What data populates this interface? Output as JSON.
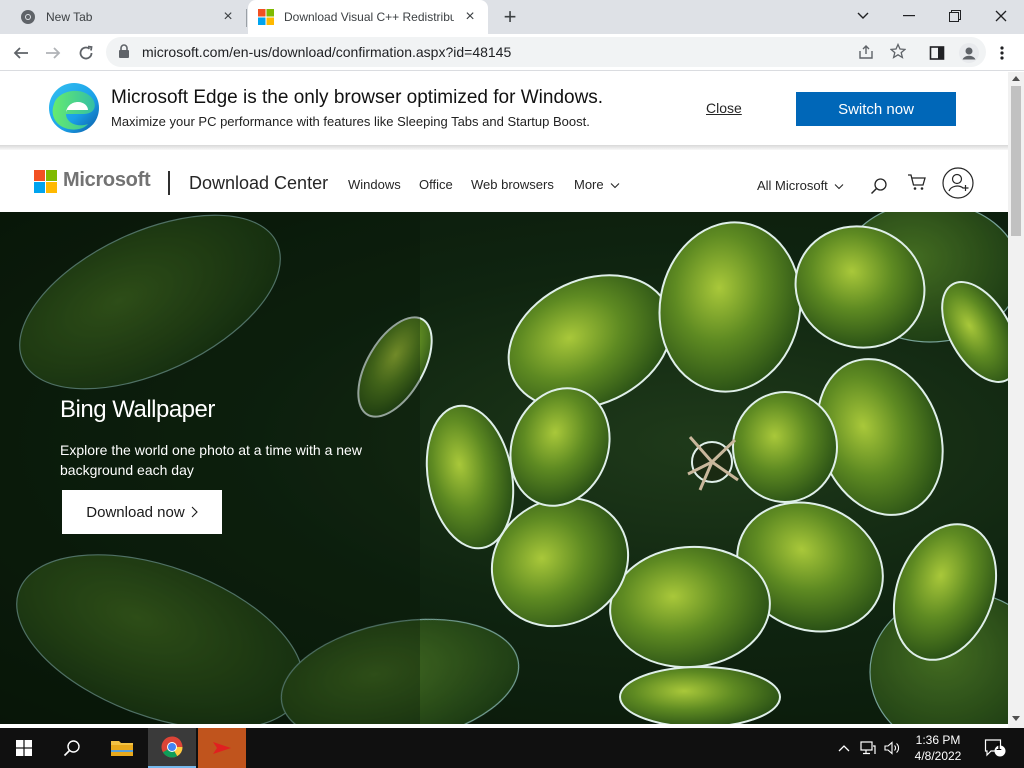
{
  "browser": {
    "tabs": [
      {
        "title": "New Tab",
        "active": false
      },
      {
        "title": "Download Visual C++ Redistribu",
        "active": true
      }
    ],
    "url": "microsoft.com/en-us/download/confirmation.aspx?id=48145"
  },
  "edge_banner": {
    "title": "Microsoft Edge is the only browser optimized for Windows.",
    "subtitle": "Maximize your PC performance with features like Sleeping Tabs and Startup Boost.",
    "close_label": "Close",
    "switch_label": "Switch now",
    "switch_color": "#0067b8"
  },
  "header": {
    "brand": "Microsoft",
    "section": "Download Center",
    "nav": [
      "Windows",
      "Office",
      "Web browsers",
      "More"
    ],
    "all_microsoft": "All Microsoft"
  },
  "hero": {
    "title": "Bing Wallpaper",
    "description": "Explore the world one photo at a time with a new background each day",
    "cta_label": "Download now"
  },
  "taskbar": {
    "time": "1:36 PM",
    "date": "4/8/2022",
    "notification_count": "1"
  },
  "colors": {
    "ms_red": "#f25022",
    "ms_green": "#7fba00",
    "ms_blue": "#00a4ef",
    "ms_yellow": "#ffb900"
  }
}
